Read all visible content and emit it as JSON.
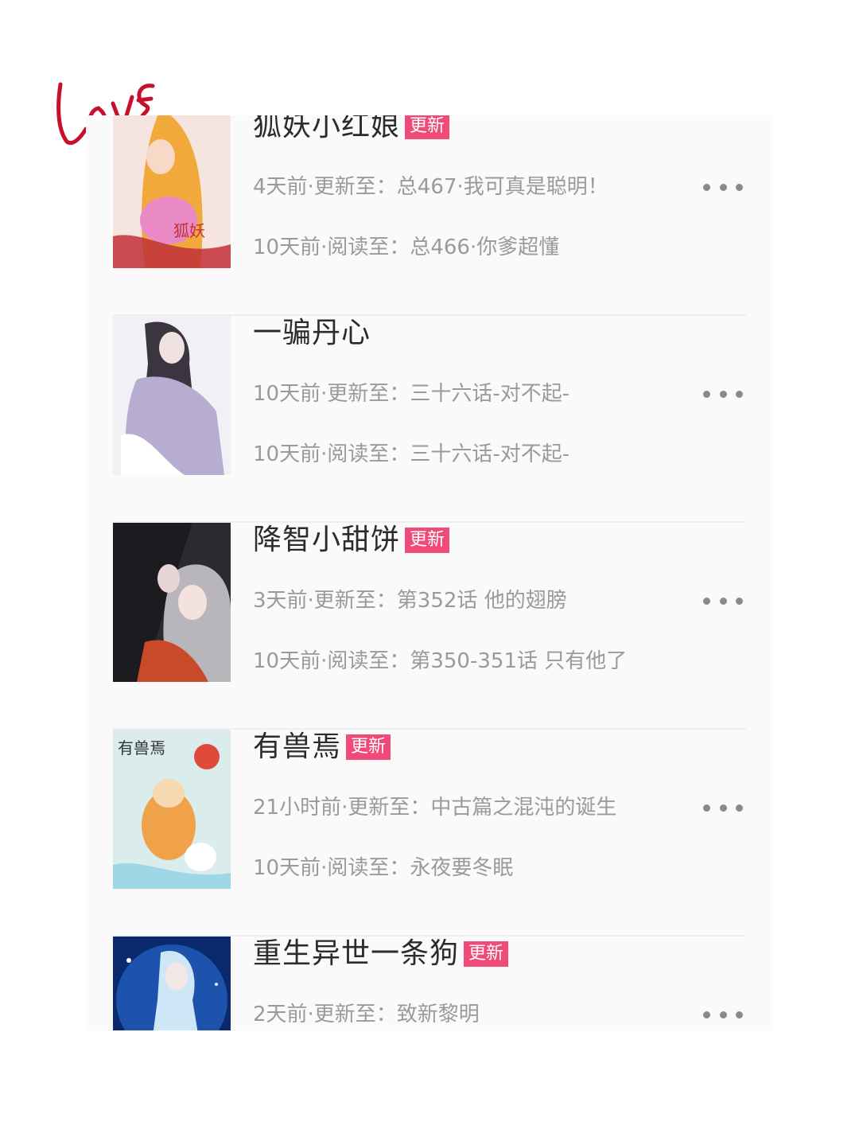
{
  "items": [
    {
      "title": "狐妖小红娘",
      "badge": "更新",
      "update": "4天前·更新至：总467·我可真是聪明！",
      "read": "10天前·阅读至：总466·你爹超懂",
      "cover_text": "狐妖"
    },
    {
      "title": "一骗丹心",
      "badge": "",
      "update": "10天前·更新至：三十六话-对不起-",
      "read": "10天前·阅读至：三十六话-对不起-"
    },
    {
      "title": "降智小甜饼",
      "badge": "更新",
      "update": "3天前·更新至：第352话 他的翅膀",
      "read": "10天前·阅读至：第350-351话 只有他了"
    },
    {
      "title": "有兽焉",
      "badge": "更新",
      "update": "21小时前·更新至：中古篇之混沌的诞生",
      "read": "10天前·阅读至：永夜要冬眠",
      "cover_text": "有兽焉"
    },
    {
      "title": "重生异世一条狗",
      "badge": "更新",
      "update": "2天前·更新至：致新黎明",
      "read": ""
    }
  ],
  "love_text": "LOVE",
  "colors": {
    "badge": "#ef4a78",
    "love": "#c8102e"
  }
}
